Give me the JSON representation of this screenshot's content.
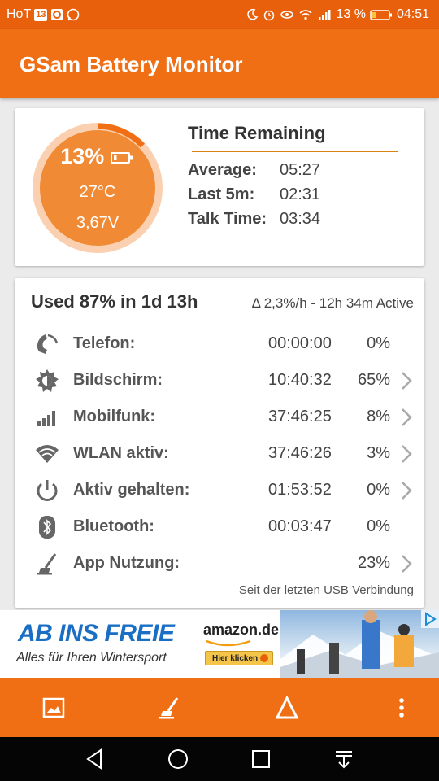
{
  "status_bar": {
    "left_text": "HoT",
    "box_text": "13",
    "battery_percent": "13 %",
    "time": "04:51"
  },
  "app": {
    "title": "GSam Battery Monitor"
  },
  "gauge": {
    "percent": "13%",
    "temperature": "27°C",
    "voltage": "3,67V",
    "level": 0.13
  },
  "time_remaining": {
    "title": "Time Remaining",
    "rows": [
      {
        "label": "Average:",
        "value": "05:27"
      },
      {
        "label": "Last 5m:",
        "value": "02:31"
      },
      {
        "label": "Talk Time:",
        "value": "03:34"
      }
    ]
  },
  "usage": {
    "title": "Used 87% in 1d 13h",
    "rate": "Δ 2,3%/h - 12h 34m Active",
    "rows": [
      {
        "icon": "phone-icon",
        "name": "Telefon:",
        "time": "00:00:00",
        "pct": "0%",
        "chevron": false
      },
      {
        "icon": "brightness-icon",
        "name": "Bildschirm:",
        "time": "10:40:32",
        "pct": "65%",
        "chevron": true
      },
      {
        "icon": "signal-bars-icon",
        "name": "Mobilfunk:",
        "time": "37:46:25",
        "pct": "8%",
        "chevron": true
      },
      {
        "icon": "wifi-icon",
        "name": "WLAN aktiv:",
        "time": "37:46:26",
        "pct": "3%",
        "chevron": true
      },
      {
        "icon": "power-icon",
        "name": "Aktiv gehalten:",
        "time": "01:53:52",
        "pct": "0%",
        "chevron": true
      },
      {
        "icon": "bluetooth-icon",
        "name": "Bluetooth:",
        "time": "00:03:47",
        "pct": "0%",
        "chevron": false
      },
      {
        "icon": "app-usage-icon",
        "name": "App Nutzung:",
        "time": "",
        "pct": "23%",
        "chevron": true
      }
    ],
    "footer": "Seit der letzten USB Verbindung"
  },
  "ad": {
    "headline": "AB INS FREIE",
    "subline": "Alles für Ihren Wintersport",
    "brand": "amazon.de",
    "button": "Hier klicken"
  },
  "colors": {
    "accent": "#f06f14",
    "status": "#e8600c",
    "divider": "#d9820f",
    "gauge": "#f08a34"
  }
}
